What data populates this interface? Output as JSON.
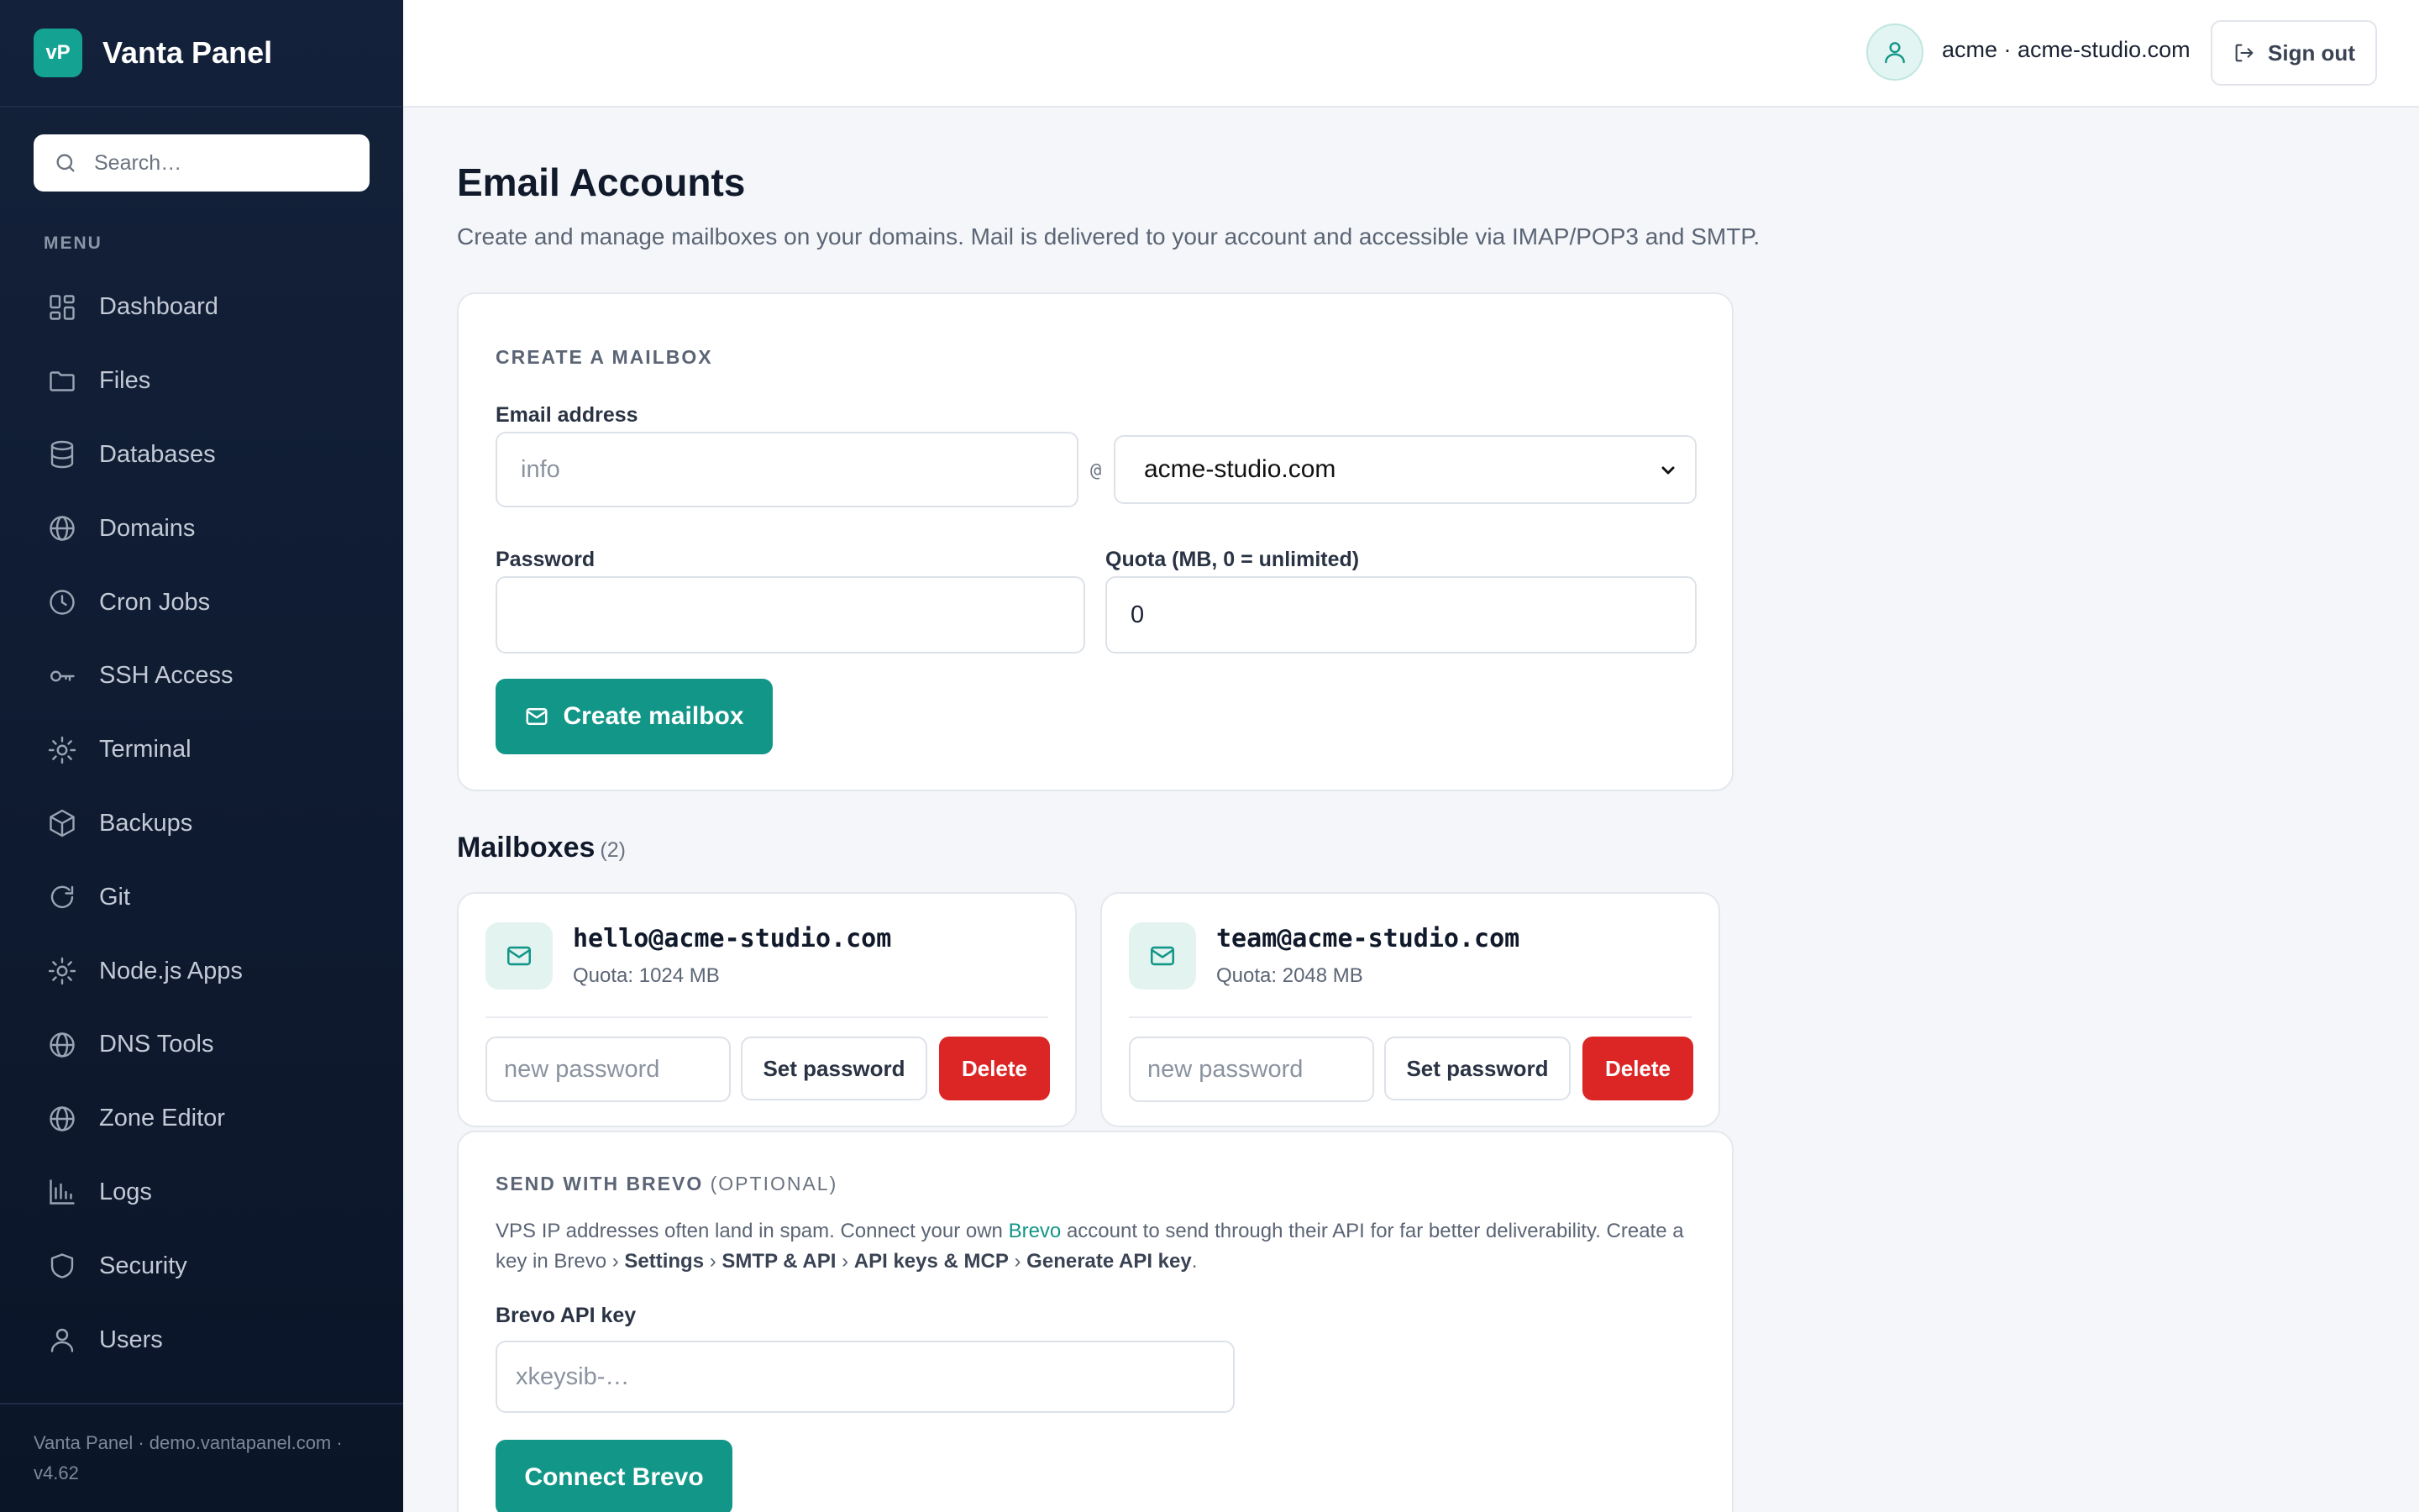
{
  "brand": {
    "logo_text": "vP",
    "name": "Vanta Panel"
  },
  "search": {
    "placeholder": "Search…"
  },
  "menu": {
    "label": "MENU",
    "items": [
      {
        "label": "Dashboard",
        "icon": "dashboard-icon"
      },
      {
        "label": "Files",
        "icon": "folder-icon"
      },
      {
        "label": "Databases",
        "icon": "database-icon"
      },
      {
        "label": "Domains",
        "icon": "globe-icon"
      },
      {
        "label": "Cron Jobs",
        "icon": "clock-icon"
      },
      {
        "label": "SSH Access",
        "icon": "key-icon"
      },
      {
        "label": "Terminal",
        "icon": "sun-icon"
      },
      {
        "label": "Backups",
        "icon": "box-icon"
      },
      {
        "label": "Git",
        "icon": "refresh-icon"
      },
      {
        "label": "Node.js Apps",
        "icon": "sun-icon"
      },
      {
        "label": "DNS Tools",
        "icon": "globe-icon"
      },
      {
        "label": "Zone Editor",
        "icon": "globe-icon"
      },
      {
        "label": "Logs",
        "icon": "bar-chart-icon"
      },
      {
        "label": "Security",
        "icon": "shield-icon"
      },
      {
        "label": "Users",
        "icon": "user-icon"
      }
    ]
  },
  "footer": {
    "text": "Vanta Panel · demo.vantapanel.com · v4.62"
  },
  "topbar": {
    "user": "acme · acme-studio.com",
    "signout_label": "Sign out"
  },
  "page": {
    "title": "Email Accounts",
    "subtitle": "Create and manage mailboxes on your domains. Mail is delivered to your account and accessible via IMAP/POP3 and SMTP."
  },
  "create": {
    "section_label": "CREATE A MAILBOX",
    "email_label": "Email address",
    "email_placeholder": "info",
    "at_symbol": "@",
    "domain_value": "acme-studio.com",
    "password_label": "Password",
    "quota_label": "Quota (MB, 0 = unlimited)",
    "quota_value": "0",
    "button_label": "Create mailbox"
  },
  "mailboxes": {
    "heading": "Mailboxes",
    "count": "(2)",
    "items": [
      {
        "address": "hello@acme-studio.com",
        "quota": "Quota: 1024 MB",
        "pw_placeholder": "new password",
        "set_label": "Set password",
        "delete_label": "Delete"
      },
      {
        "address": "team@acme-studio.com",
        "quota": "Quota: 2048 MB",
        "pw_placeholder": "new password",
        "set_label": "Set password",
        "delete_label": "Delete"
      }
    ]
  },
  "brevo": {
    "section_label": "SEND WITH BREVO",
    "optional": "(OPTIONAL)",
    "desc_1": "VPS IP addresses often land in spam. Connect your own ",
    "desc_link": "Brevo",
    "desc_2": " account to send through their API for far better deliverability. Create a key in Brevo › ",
    "step_1": "Settings",
    "sep": " › ",
    "step_2": "SMTP & API",
    "step_3": "API keys & MCP",
    "step_4": "Generate API key",
    "period": ".",
    "api_label": "Brevo API key",
    "api_placeholder": "xkeysib-…",
    "button_label": "Connect Brevo"
  },
  "colors": {
    "accent": "#129688",
    "danger": "#dc2626",
    "sidebar": "#13213a"
  }
}
